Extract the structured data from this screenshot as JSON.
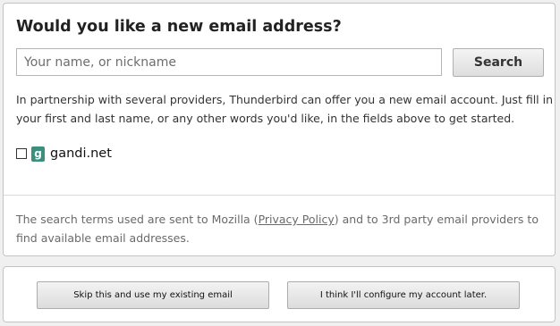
{
  "header": {
    "title": "Would you like a new email address?"
  },
  "search": {
    "placeholder": "Your name, or nickname",
    "value": "",
    "button_label": "Search"
  },
  "description": "In partnership with several providers, Thunderbird can offer you a new email account. Just fill in your first and last name, or any other words you'd like, in the fields above to get started.",
  "providers": [
    {
      "name": "gandi.net",
      "checked": false,
      "icon": "gandi-logo-icon",
      "icon_color": "#3c8f7d"
    }
  ],
  "privacy": {
    "before": "The search terms used are sent to Mozilla (",
    "link_label": "Privacy Policy",
    "after": ") and to 3rd party email providers to find available email addresses."
  },
  "footer": {
    "skip_label": "Skip this and use my existing email",
    "later_label": "I think I'll configure my account later."
  }
}
